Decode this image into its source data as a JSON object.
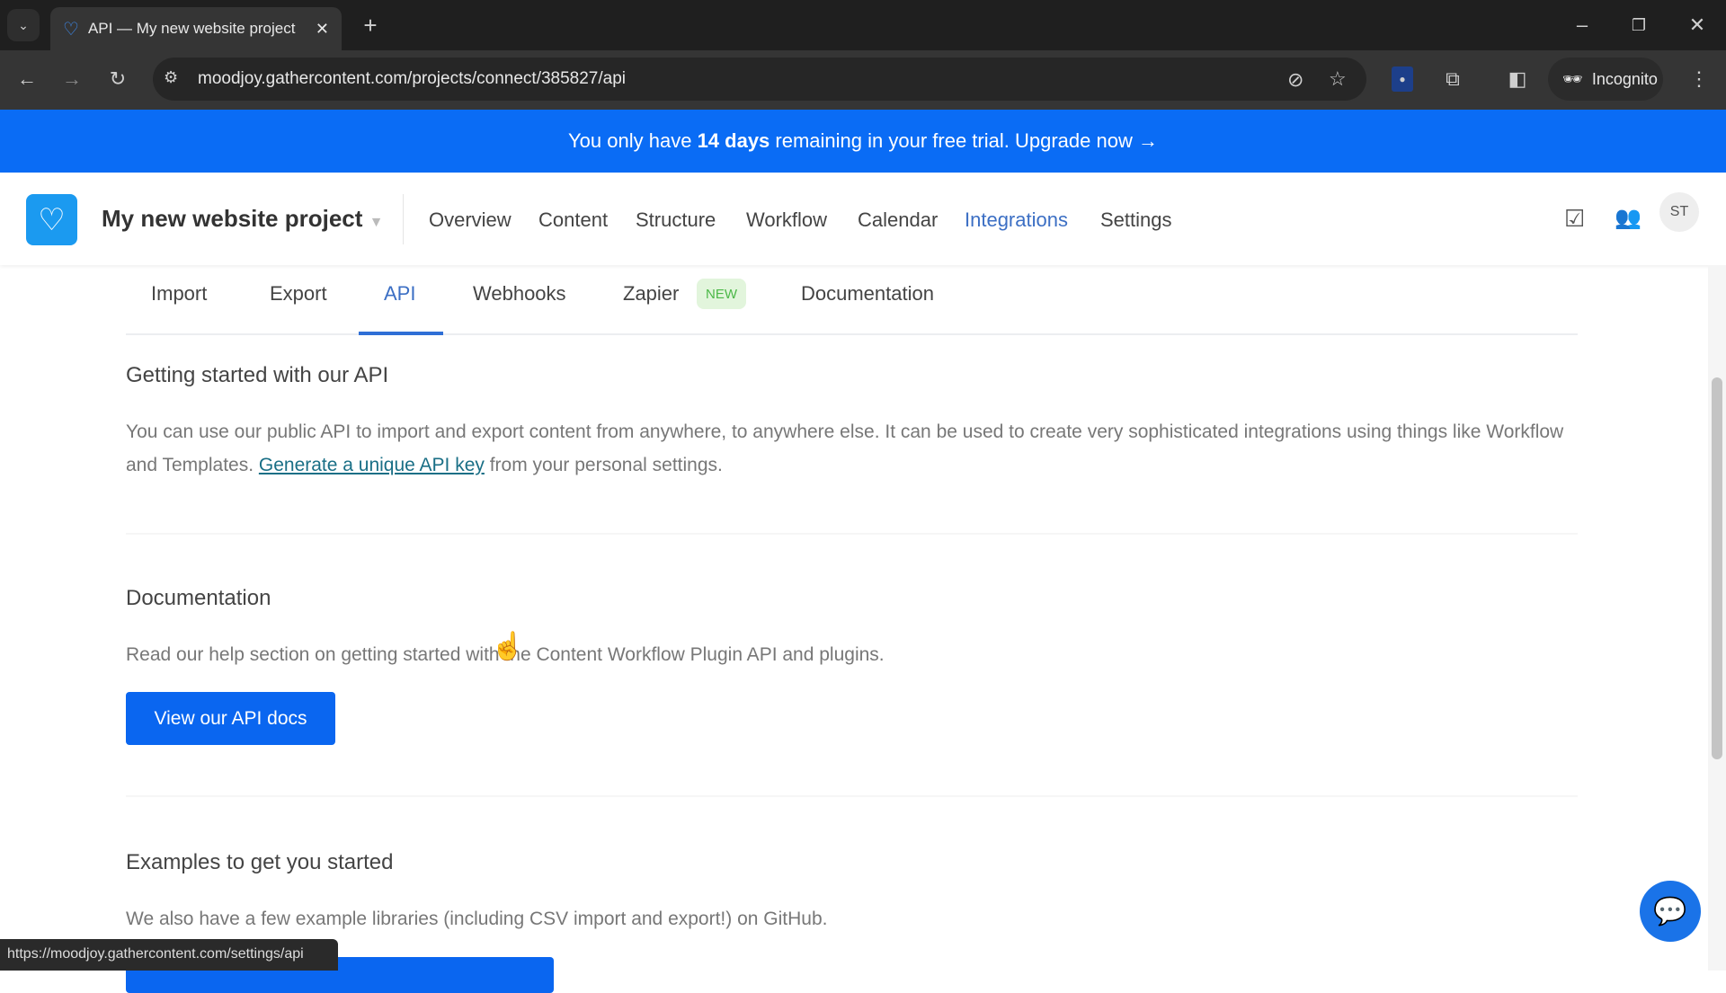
{
  "browser": {
    "tab_title": "API — My new website project",
    "url": "moodjoy.gathercontent.com/projects/connect/385827/api",
    "incognito_label": "Incognito",
    "status_url": "https://moodjoy.gathercontent.com/settings/api"
  },
  "banner": {
    "pre": "You only have ",
    "bold": "14 days",
    "post": " remaining in your free trial. ",
    "link": "Upgrade now →"
  },
  "header": {
    "project_title": "My new website project",
    "nav": [
      "Overview",
      "Content",
      "Structure",
      "Workflow",
      "Calendar",
      "Integrations",
      "Settings"
    ],
    "active_nav": "Integrations",
    "avatar": "ST"
  },
  "subtabs": {
    "items": [
      "Import",
      "Export",
      "API",
      "Webhooks",
      "Zapier",
      "Documentation"
    ],
    "active": "API",
    "badge": "NEW"
  },
  "sections": {
    "api": {
      "title": "Getting started with our API",
      "text1": "You can use our public API to import and export content from anywhere, to anywhere else. It can be used to create very sophisticated integrations using things like Workflow and Templates. ",
      "link": "Generate a unique API key",
      "text2": " from your personal settings."
    },
    "docs": {
      "title": "Documentation",
      "text": "Read our help section on getting started with the Content Workflow Plugin API and plugins.",
      "button": "View our API docs"
    },
    "examples": {
      "title": "Examples to get you started",
      "text": "We also have a few example libraries (including CSV import and export!) on GitHub."
    }
  },
  "colors": {
    "accent": "#0a6cf5",
    "link": "#1a6f86",
    "badge_bg": "#e2f5dc",
    "badge_text": "#4cb848"
  }
}
